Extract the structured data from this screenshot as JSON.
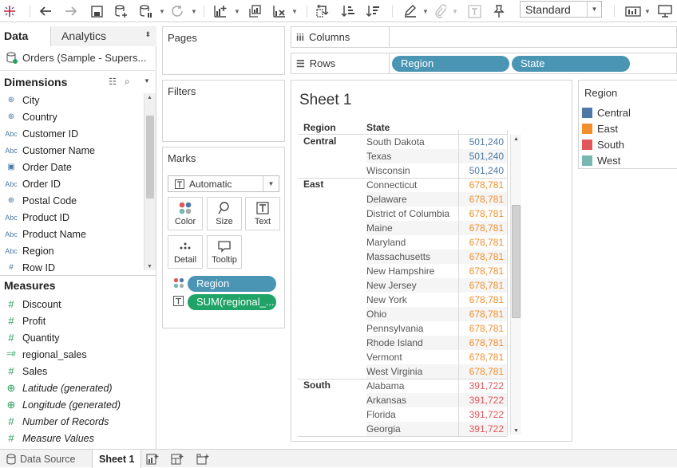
{
  "toolbar": {
    "logo_icon": "tableau-logo-icon",
    "standard_label": "Standard"
  },
  "data_pane": {
    "tab_data": "Data",
    "tab_analytics": "Analytics",
    "datasource": "Orders (Sample - Supers...",
    "dimensions_header": "Dimensions",
    "dimensions": [
      {
        "type": "geo",
        "name": "City"
      },
      {
        "type": "geo",
        "name": "Country"
      },
      {
        "type": "abc",
        "name": "Customer ID"
      },
      {
        "type": "abc",
        "name": "Customer Name"
      },
      {
        "type": "date",
        "name": "Order Date"
      },
      {
        "type": "abc",
        "name": "Order ID"
      },
      {
        "type": "geo",
        "name": "Postal Code"
      },
      {
        "type": "abc",
        "name": "Product ID"
      },
      {
        "type": "abc",
        "name": "Product Name"
      },
      {
        "type": "abc",
        "name": "Region"
      },
      {
        "type": "num",
        "name": "Row ID"
      }
    ],
    "measures_header": "Measures",
    "measures": [
      {
        "type": "num",
        "name": "Discount"
      },
      {
        "type": "num",
        "name": "Profit"
      },
      {
        "type": "num",
        "name": "Quantity"
      },
      {
        "type": "calc",
        "name": "regional_sales"
      },
      {
        "type": "num",
        "name": "Sales"
      },
      {
        "type": "geo",
        "name": "Latitude (generated)"
      },
      {
        "type": "geo",
        "name": "Longitude (generated)"
      },
      {
        "type": "num",
        "name": "Number of Records"
      },
      {
        "type": "num",
        "name": "Measure Values"
      }
    ]
  },
  "cards": {
    "pages": "Pages",
    "filters": "Filters",
    "marks": "Marks",
    "mark_type": "Automatic",
    "color": "Color",
    "size": "Size",
    "text": "Text",
    "detail": "Detail",
    "tooltip": "Tooltip",
    "pill_region": "Region",
    "pill_sum": "SUM(regional_..."
  },
  "shelves": {
    "columns": "Columns",
    "rows": "Rows",
    "rows_pills": [
      "Region",
      "State"
    ]
  },
  "view": {
    "title": "Sheet 1",
    "col_region": "Region",
    "col_state": "State",
    "groups": [
      {
        "region": "Central",
        "color": "#4e79a7",
        "rows": [
          [
            "South Dakota",
            "501,240"
          ],
          [
            "Texas",
            "501,240"
          ],
          [
            "Wisconsin",
            "501,240"
          ]
        ]
      },
      {
        "region": "East",
        "color": "#f28e2b",
        "rows": [
          [
            "Connecticut",
            "678,781"
          ],
          [
            "Delaware",
            "678,781"
          ],
          [
            "District of Columbia",
            "678,781"
          ],
          [
            "Maine",
            "678,781"
          ],
          [
            "Maryland",
            "678,781"
          ],
          [
            "Massachusetts",
            "678,781"
          ],
          [
            "New Hampshire",
            "678,781"
          ],
          [
            "New Jersey",
            "678,781"
          ],
          [
            "New York",
            "678,781"
          ],
          [
            "Ohio",
            "678,781"
          ],
          [
            "Pennsylvania",
            "678,781"
          ],
          [
            "Rhode Island",
            "678,781"
          ],
          [
            "Vermont",
            "678,781"
          ],
          [
            "West Virginia",
            "678,781"
          ]
        ]
      },
      {
        "region": "South",
        "color": "#e15759",
        "rows": [
          [
            "Alabama",
            "391,722"
          ],
          [
            "Arkansas",
            "391,722"
          ],
          [
            "Florida",
            "391,722"
          ],
          [
            "Georgia",
            "391,722"
          ]
        ]
      }
    ]
  },
  "legend": {
    "title": "Region",
    "items": [
      {
        "label": "Central",
        "color": "#4e79a7"
      },
      {
        "label": "East",
        "color": "#f28e2b"
      },
      {
        "label": "South",
        "color": "#e15759"
      },
      {
        "label": "West",
        "color": "#76b7b2"
      }
    ]
  },
  "bottom": {
    "data_source": "Data Source",
    "sheet1": "Sheet 1"
  }
}
